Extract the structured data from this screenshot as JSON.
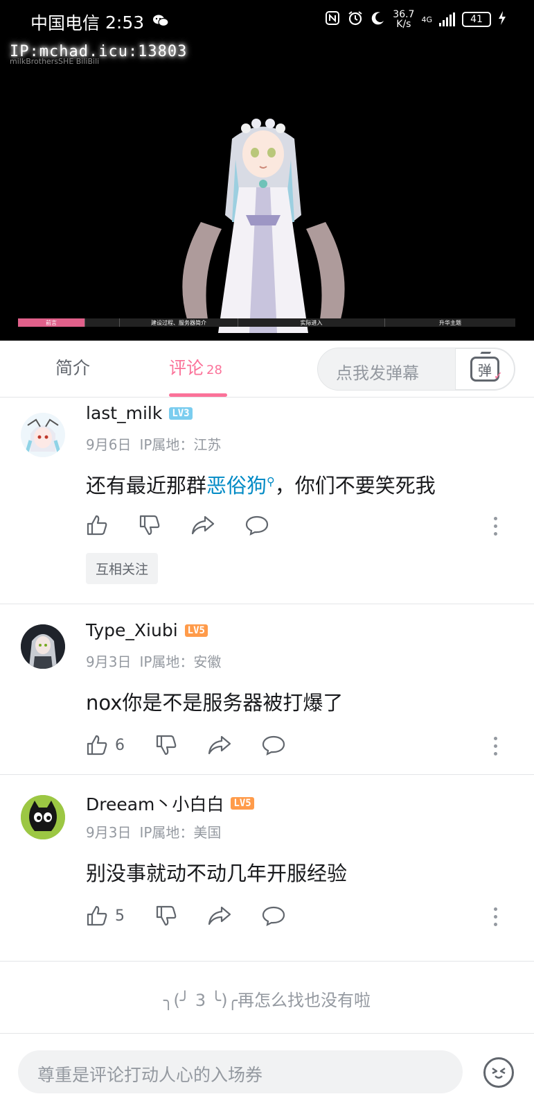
{
  "status_bar": {
    "carrier": "中国电信",
    "time": "2:53",
    "net_speed_value": "36.7",
    "net_speed_unit": "K/s",
    "network": "4G",
    "battery": "41"
  },
  "video": {
    "watermark": "IP:mchad.icu:13803",
    "watermark_sub": "milkBrothersSHE  BiliBili",
    "chapters": [
      {
        "label": "前言",
        "played": true
      },
      {
        "label": "建设过程、服务器简介",
        "played": false
      },
      {
        "label": "实际进入",
        "played": false
      },
      {
        "label": "升华主题",
        "played": false
      }
    ]
  },
  "tabs": {
    "intro_label": "简介",
    "comments_label": "评论",
    "comments_count": "28"
  },
  "danmaku": {
    "placeholder": "点我发弹幕",
    "icon_label": "弹"
  },
  "comments": [
    {
      "username": "last_milk",
      "level": "LV3",
      "date": "9月6日",
      "ip": "IP属地：江苏",
      "content_before": "还有最近那群",
      "content_keyword": "恶俗狗",
      "content_after": "，你们不要笑死我",
      "likes": "",
      "tag": "互相关注"
    },
    {
      "username": "Type_Xiubi",
      "level": "LV5",
      "date": "9月3日",
      "ip": "IP属地：安徽",
      "content": "nox你是不是服务器被打爆了",
      "likes": "6"
    },
    {
      "username": "Dreeam丶小白白",
      "level": "LV5",
      "date": "9月3日",
      "ip": "IP属地：美国",
      "content": "别没事就动不动几年开服经验",
      "likes": "5"
    }
  ],
  "end_message": "╮(╯ 3 ╰)╭再怎么找也没有啦",
  "comment_input": {
    "placeholder": "尊重是评论打动人心的入场券"
  },
  "colors": {
    "accent": "#fb7299",
    "keyword_link": "#008ac5",
    "lv3": "#7bcdef",
    "lv5": "#ff9b4a"
  }
}
